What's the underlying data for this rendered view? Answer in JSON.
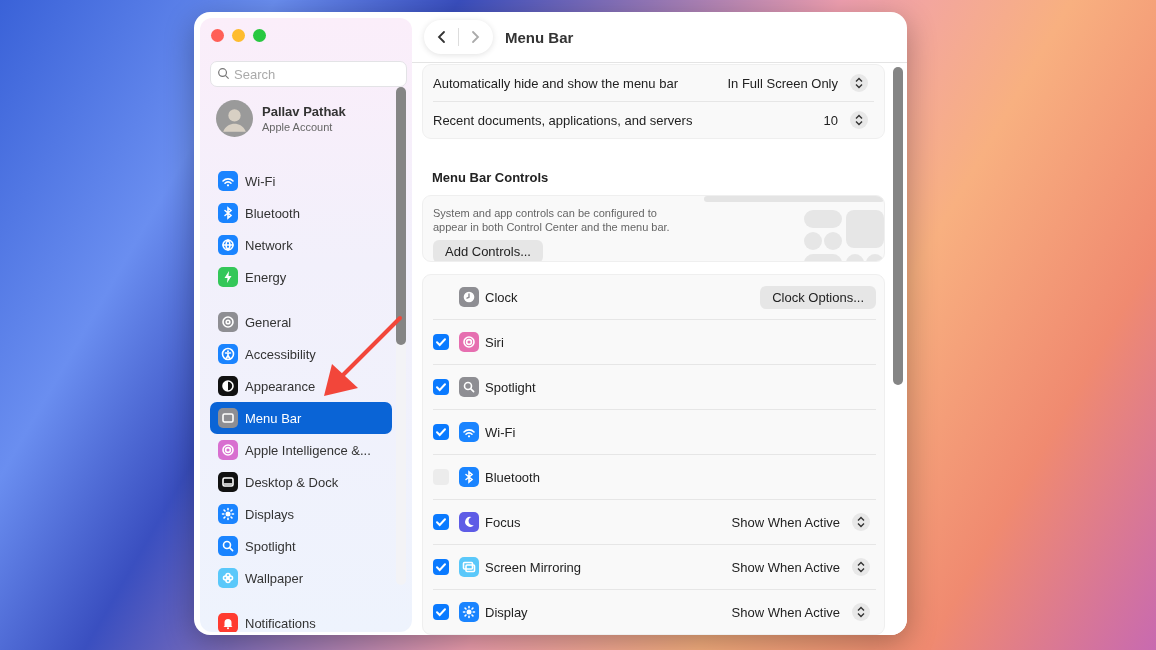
{
  "sidebar": {
    "search": {
      "placeholder": "Search"
    },
    "account": {
      "name": "Pallav Pathak",
      "subtitle": "Apple Account"
    },
    "groups": [
      {
        "items": [
          {
            "label": "Wi-Fi",
            "kind": "wifi",
            "color": "#1a84ff",
            "selected": false
          },
          {
            "label": "Bluetooth",
            "kind": "bluetooth",
            "color": "#1a84ff",
            "selected": false
          },
          {
            "label": "Network",
            "kind": "globe",
            "color": "#1a84ff",
            "selected": false
          },
          {
            "label": "Energy",
            "kind": "bolt",
            "color": "#34c759",
            "selected": false
          }
        ]
      },
      {
        "items": [
          {
            "label": "General",
            "kind": "gear",
            "color": "#8e8e93",
            "selected": false
          },
          {
            "label": "Accessibility",
            "kind": "person",
            "color": "#1a84ff",
            "selected": false
          },
          {
            "label": "Appearance",
            "kind": "halfcircle",
            "color": "#111111",
            "selected": false
          },
          {
            "label": "Menu Bar",
            "kind": "window",
            "color": "#8e8e93",
            "selected": true
          },
          {
            "label": "Apple Intelligence &...",
            "kind": "ring",
            "color": "#d86fd0",
            "selected": false
          },
          {
            "label": "Desktop & Dock",
            "kind": "dock",
            "color": "#111111",
            "selected": false
          },
          {
            "label": "Displays",
            "kind": "sun",
            "color": "#1a84ff",
            "selected": false
          },
          {
            "label": "Spotlight",
            "kind": "search",
            "color": "#1a84ff",
            "selected": false
          },
          {
            "label": "Wallpaper",
            "kind": "flower",
            "color": "#5ac8fa",
            "selected": false
          }
        ]
      },
      {
        "items": [
          {
            "label": "Notifications",
            "kind": "bell",
            "color": "#ff3b30",
            "selected": false
          }
        ]
      }
    ]
  },
  "header": {
    "title": "Menu Bar"
  },
  "settings": [
    {
      "label": "Automatically hide and show the menu bar",
      "value": "In Full Screen Only"
    },
    {
      "label": "Recent documents, applications, and servers",
      "value": "10"
    }
  ],
  "controls_section": {
    "heading": "Menu Bar Controls",
    "description": "System and app controls can be configured to appear in both Control Center and the menu bar.",
    "button": "Add Controls..."
  },
  "controls": [
    {
      "kind": "button",
      "label": "Clock",
      "color": "#8e8e93",
      "button": "Clock Options..."
    },
    {
      "kind": "check",
      "label": "Siri",
      "color": "#e66fb0",
      "checked": true
    },
    {
      "kind": "check",
      "label": "Spotlight",
      "color": "#8e8e93",
      "checked": true
    },
    {
      "kind": "check",
      "label": "Wi-Fi",
      "color": "#1a84ff",
      "checked": true
    },
    {
      "kind": "check",
      "label": "Bluetooth",
      "color": "#1a84ff",
      "checked": false
    },
    {
      "kind": "check",
      "label": "Focus",
      "color": "#5e5ce6",
      "checked": true,
      "value": "Show When Active"
    },
    {
      "kind": "check",
      "label": "Screen Mirroring",
      "color": "#5ac8fa",
      "checked": true,
      "value": "Show When Active"
    },
    {
      "kind": "check",
      "label": "Display",
      "color": "#1a84ff",
      "checked": true,
      "value": "Show When Active"
    }
  ]
}
